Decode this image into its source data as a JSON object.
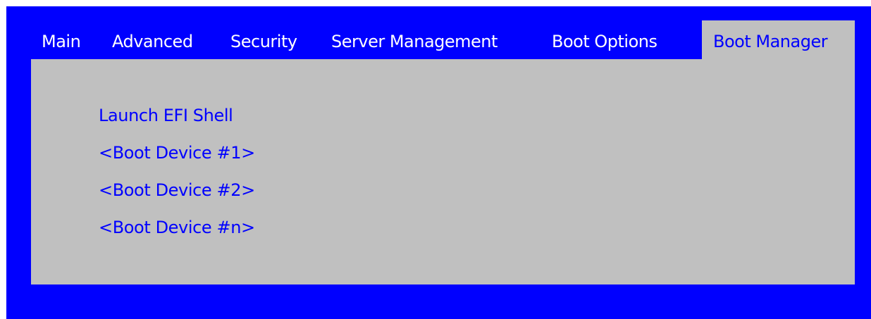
{
  "colors": {
    "frame_background": "#0000ff",
    "panel_background": "#c0c0c0",
    "tab_text": "#ffffff",
    "active_tab_text": "#0000ff",
    "menu_text": "#0000ff"
  },
  "tabs": [
    {
      "label": "Main",
      "active": false
    },
    {
      "label": "Advanced",
      "active": false
    },
    {
      "label": "Security",
      "active": false
    },
    {
      "label": "Server Management",
      "active": false
    },
    {
      "label": "Boot Options",
      "active": false
    },
    {
      "label": "Boot Manager",
      "active": true
    }
  ],
  "menu": {
    "items": [
      {
        "label": "Launch EFI Shell"
      },
      {
        "label": "<Boot Device #1>"
      },
      {
        "label": "<Boot Device #2>"
      },
      {
        "label": "<Boot Device #n>"
      }
    ]
  }
}
